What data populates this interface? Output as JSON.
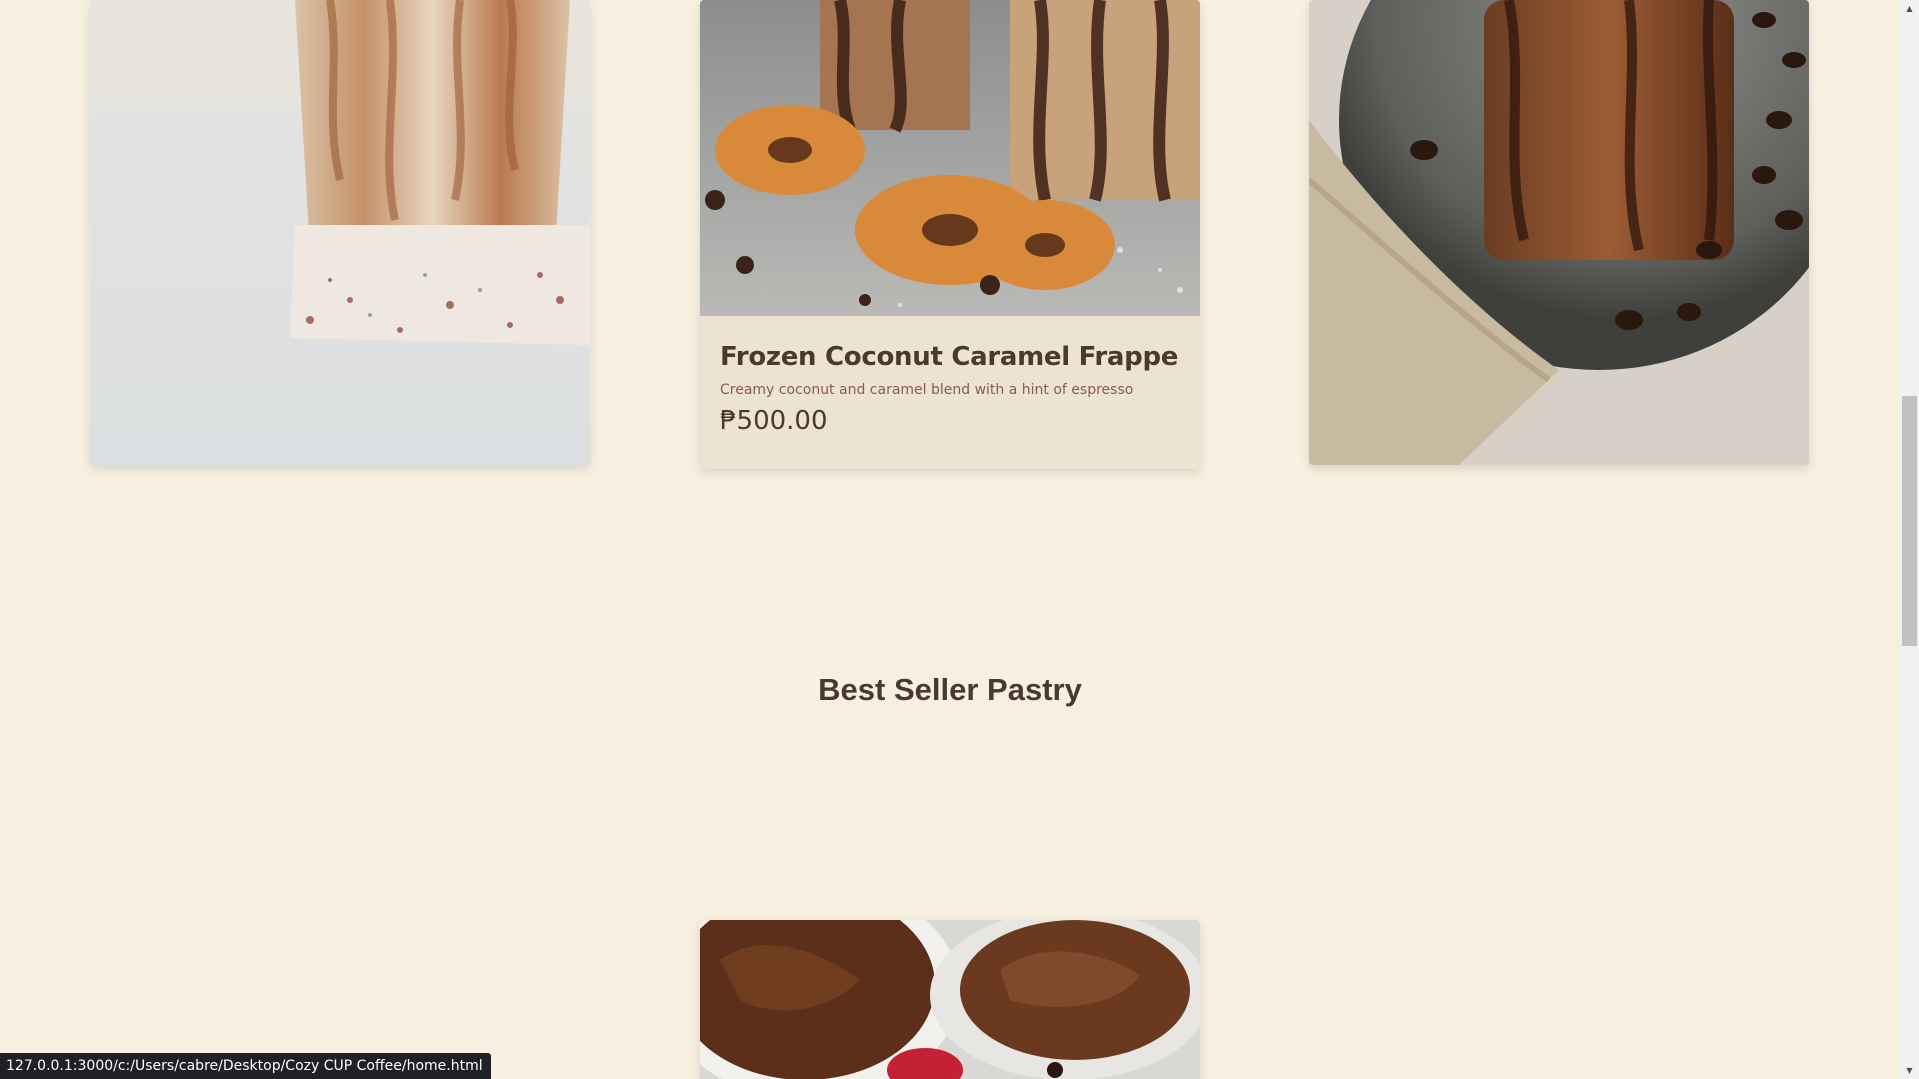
{
  "products": [
    {
      "image_icon": "iced-caramel-latte-photo",
      "title": "",
      "description": "",
      "price": ""
    },
    {
      "image_icon": "frappe-with-coconut-cookies-photo",
      "title": "Frozen Coconut Caramel Frappe",
      "description": "Creamy coconut and caramel blend with a hint of espresso",
      "price": "₱500.00"
    },
    {
      "image_icon": "chocolate-coffee-glass-with-beans-photo",
      "title": "",
      "description": "",
      "price": ""
    }
  ],
  "pastry_section": {
    "title": "Best Seller Pastry",
    "first_item_image_icon": "chocolate-spread-pastry-photo"
  },
  "status_bar": {
    "url": "127.0.0.1:3000/c:/Users/cabre/Desktop/Cozy CUP Coffee/home.html"
  },
  "colors": {
    "page_background": "#f7f0e0",
    "card_background": "#ece3d2",
    "title_text": "#4a3a2e",
    "description_text": "#8a5a58"
  }
}
